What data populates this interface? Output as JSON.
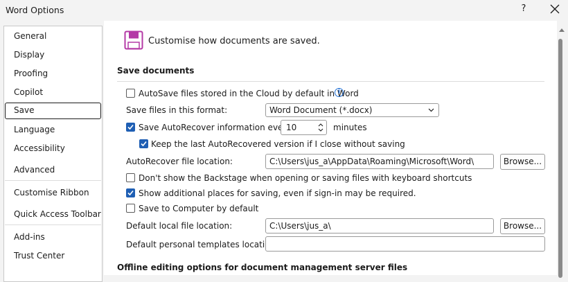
{
  "window": {
    "title": "Word Options",
    "help_label": "?"
  },
  "sidebar": {
    "items": [
      {
        "label": "General"
      },
      {
        "label": "Display"
      },
      {
        "label": "Proofing"
      },
      {
        "label": "Copilot"
      },
      {
        "label": "Save",
        "selected": true
      },
      {
        "label": "Language"
      },
      {
        "label": "Accessibility"
      },
      {
        "label": "Advanced"
      },
      {
        "label": "Customise Ribbon"
      },
      {
        "label": "Quick Access Toolbar"
      },
      {
        "label": "Add-ins"
      },
      {
        "label": "Trust Center"
      }
    ]
  },
  "header": {
    "icon": "save-icon",
    "text": "Customise how documents are saved."
  },
  "save_documents": {
    "title": "Save documents",
    "autosave": {
      "label": "AutoSave files stored in the Cloud by default in Word",
      "checked": false
    },
    "format_label": "Save files in this format:",
    "format_value": "Word Document (*.docx)",
    "autorecover": {
      "label": "Save AutoRecover information every",
      "checked": true,
      "minutes": "10",
      "minutes_label": "minutes"
    },
    "keep_last": {
      "label": "Keep the last AutoRecovered version if I close without saving",
      "checked": true
    },
    "autorecover_location_label": "AutoRecover file location:",
    "autorecover_location_value": "C:\\Users\\jus_a\\AppData\\Roaming\\Microsoft\\Word\\",
    "browse_label": "Browse...",
    "no_backstage": {
      "label": "Don't show the Backstage when opening or saving files with keyboard shortcuts",
      "checked": false
    },
    "additional_places": {
      "label": "Show additional places for saving, even if sign-in may be required.",
      "checked": true
    },
    "save_to_computer": {
      "label": "Save to Computer by default",
      "checked": false
    },
    "default_local_label": "Default local file location:",
    "default_local_value": "C:\\Users\\jus_a\\",
    "templates_label": "Default personal templates location:",
    "templates_value": ""
  },
  "offline": {
    "title": "Offline editing options for document management server files"
  },
  "colors": {
    "accent": "#1f5fb4",
    "save_icon": "#b43aa6"
  }
}
